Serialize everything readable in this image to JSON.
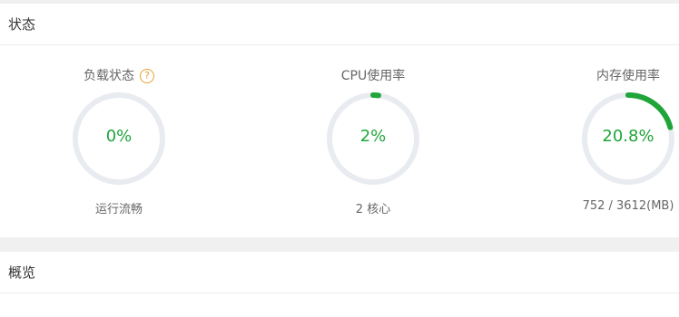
{
  "status_panel": {
    "title": "状态"
  },
  "gauges": [
    {
      "label": "负载状态",
      "help": "?",
      "value_text": "0%",
      "fraction": 0.0,
      "desc": "运行流畅"
    },
    {
      "label": "CPU使用率",
      "value_text": "2%",
      "fraction": 0.02,
      "desc": "2 核心"
    },
    {
      "label": "内存使用率",
      "value_text": "20.8%",
      "fraction": 0.208,
      "desc": "752 / 3612(MB)"
    }
  ],
  "overview_panel": {
    "title": "概览"
  },
  "colors": {
    "accent": "#20a53a",
    "track": "#e8ebf0",
    "help": "#e8a030"
  }
}
